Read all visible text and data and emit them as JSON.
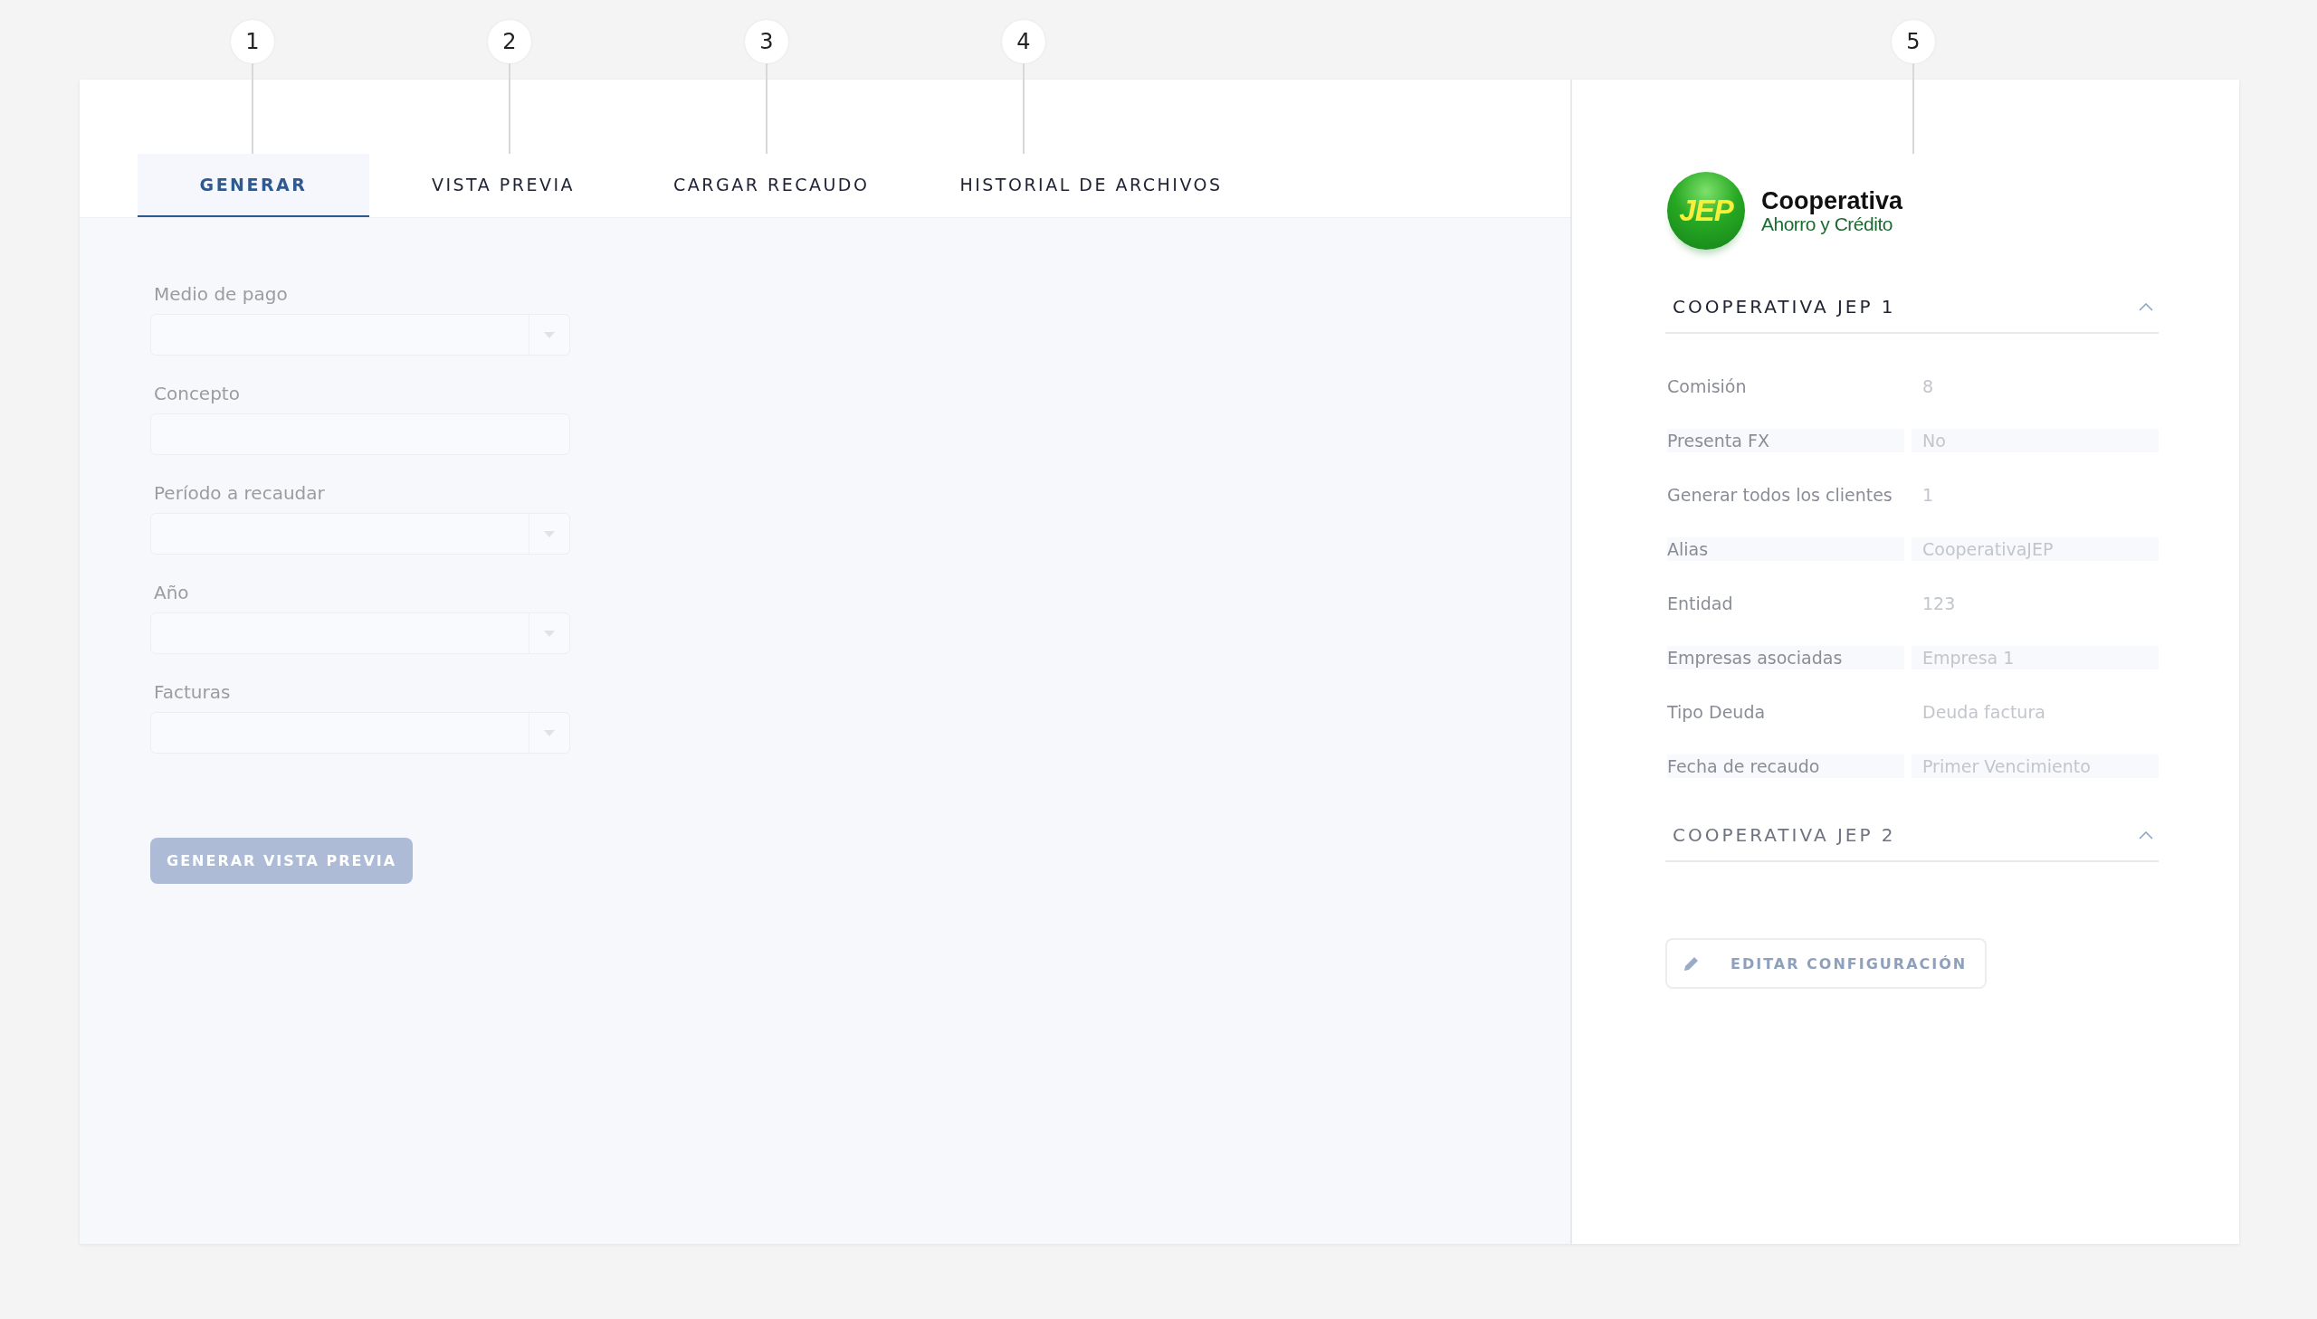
{
  "callouts": [
    "1",
    "2",
    "3",
    "4",
    "5"
  ],
  "tabs": [
    {
      "label": "GENERAR",
      "selected": true
    },
    {
      "label": "VISTA PREVIA",
      "selected": false
    },
    {
      "label": "CARGAR RECAUDO",
      "selected": false
    },
    {
      "label": "HISTORIAL DE ARCHIVOS",
      "selected": false
    }
  ],
  "form": {
    "fields": [
      {
        "label": "Medio de pago",
        "kind": "select"
      },
      {
        "label": "Concepto",
        "kind": "text"
      },
      {
        "label": "Período a recaudar",
        "kind": "select"
      },
      {
        "label": "Año",
        "kind": "select"
      },
      {
        "label": "Facturas",
        "kind": "select"
      }
    ],
    "submit_button": "GENERAR VISTA PREVIA"
  },
  "logo": {
    "badge": "JEP",
    "name": "Cooperativa",
    "tagline": "Ahorro y Crédito"
  },
  "sections": [
    {
      "title": "COOPERATIVA JEP 1",
      "rows": [
        {
          "label": "Comisión",
          "value": "8"
        },
        {
          "label": "Presenta FX",
          "value": "No"
        },
        {
          "label": "Generar todos los clientes",
          "value": "1"
        },
        {
          "label": "Alias",
          "value": "CooperativaJEP"
        },
        {
          "label": "Entidad",
          "value": "123"
        },
        {
          "label": "Empresas asociadas",
          "value": "Empresa 1"
        },
        {
          "label": "Tipo Deuda",
          "value": "Deuda factura"
        },
        {
          "label": "Fecha de recaudo",
          "value": "Primer Vencimiento"
        }
      ]
    },
    {
      "title": "COOPERATIVA JEP 2"
    }
  ],
  "edit_button": "EDITAR CONFIGURACIÓN"
}
